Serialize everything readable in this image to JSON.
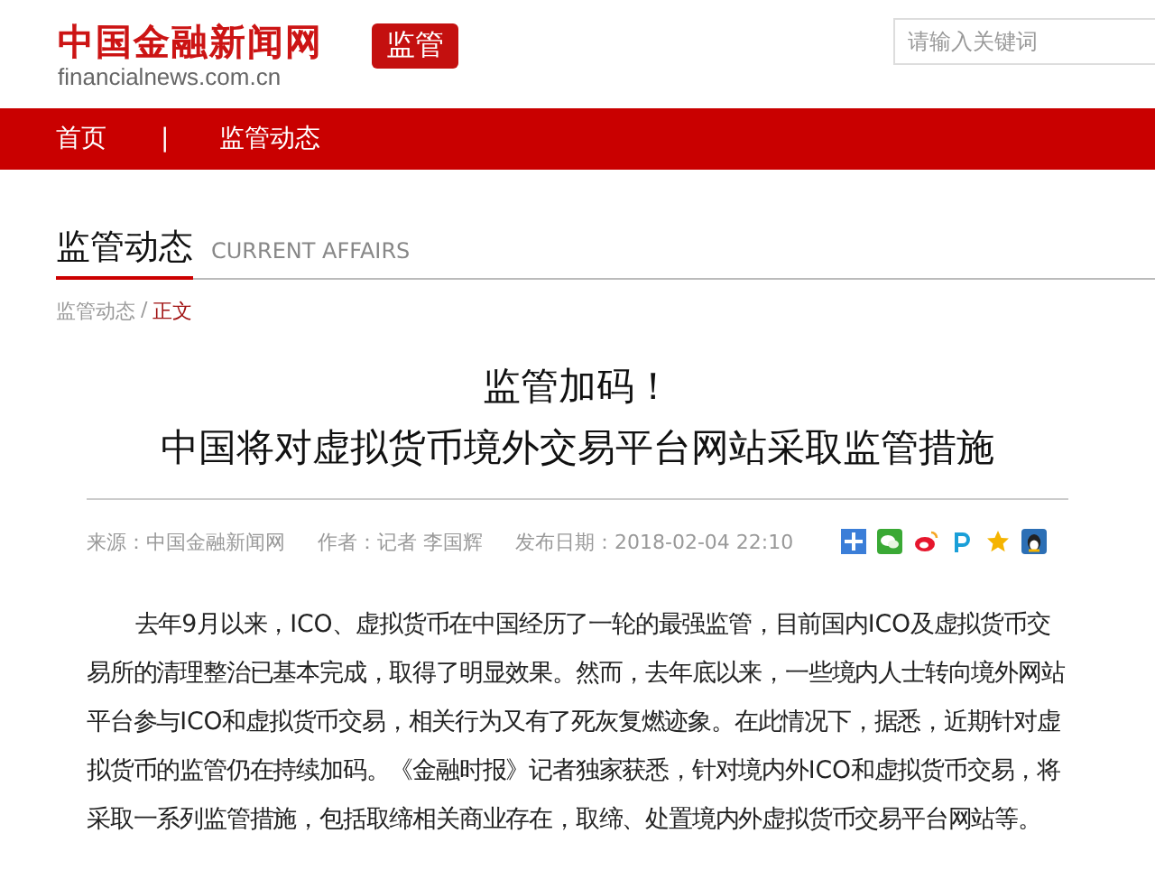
{
  "header": {
    "logo_title": "中国金融新闻网",
    "logo_domain": "financialnews.com.cn",
    "channel_badge": "监管",
    "search": {
      "placeholder": "请输入关键词"
    }
  },
  "nav": {
    "items": [
      "首页",
      "监管动态"
    ],
    "separator": "|"
  },
  "section": {
    "title": "监管动态",
    "subtitle": "CURRENT AFFAIRS"
  },
  "breadcrumb": {
    "items": [
      "监管动态",
      "正文"
    ],
    "separator": "/"
  },
  "article": {
    "title_lines": [
      "监管加码！",
      "中国将对虚拟货币境外交易平台网站采取监管措施"
    ],
    "meta": [
      "来源：中国金融新闻网",
      "作者：记者 李国辉",
      "发布日期：2018-02-04 22:10"
    ],
    "paragraph": "去年9月以来，ICO、虚拟货币在中国经历了一轮的最强监管，目前国内ICO及虚拟货币交易所的清理整治已基本完成，取得了明显效果。然而，去年底以来，一些境内人士转向境外网站平台参与ICO和虚拟货币交易，相关行为又有了死灰复燃迹象。在此情况下，据悉，近期针对虚拟货币的监管仍在持续加码。《金融时报》记者独家获悉，针对境内外ICO和虚拟货币交易，将采取一系列监管措施，包括取缔相关商业存在，取缔、处置境内外虚拟货币交易平台网站等。"
  }
}
